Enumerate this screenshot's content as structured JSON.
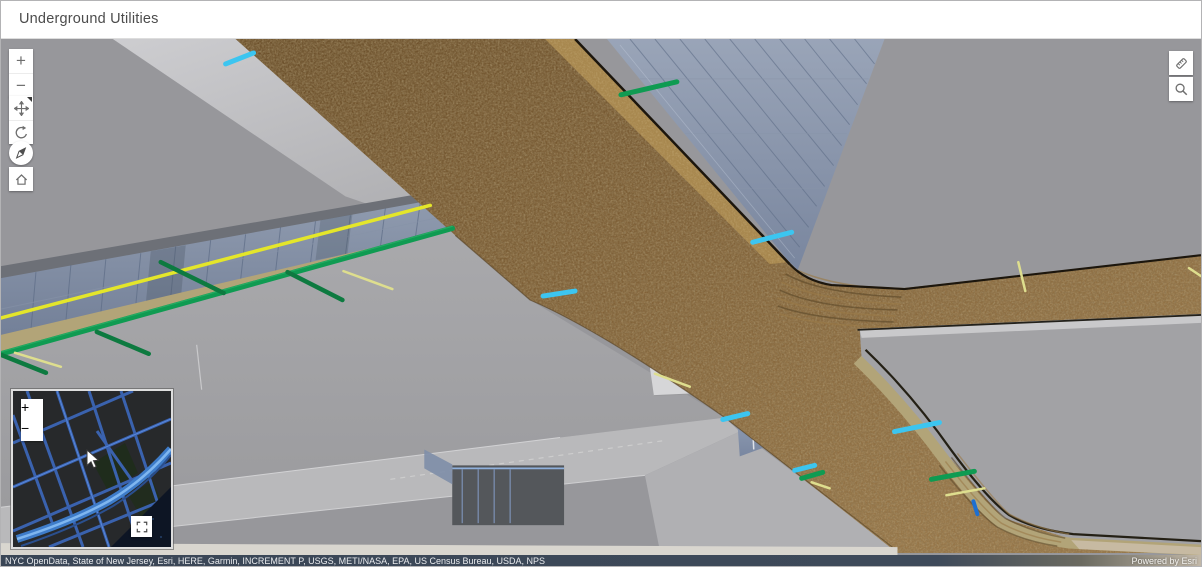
{
  "header": {
    "title": "Underground Utilities"
  },
  "navigation": {
    "zoom_in": "+",
    "zoom_out": "−",
    "left_tools": [
      "zoom-in",
      "zoom-out",
      "pan",
      "rotate",
      "compass",
      "home"
    ],
    "right_tools": [
      "measure",
      "search"
    ]
  },
  "minimap": {
    "zoom_in": "+",
    "zoom_out": "−",
    "colors": {
      "bg": "#27292b",
      "road": "#3a62ae",
      "road_bright": "#5d8de0",
      "highway": "#3e7cc9",
      "highway_core": "#7fb6ef",
      "water": "#0d1524",
      "park": "#1f2d1a"
    }
  },
  "attribution": {
    "sources": "NYC OpenData, State of New Jersey, Esri, HERE, Garmin, INCREMENT P, USGS, METI/NASA, EPA, US Census Bureau, USDA, NPS",
    "powered_by": "Powered by Esri",
    "bar_color": "#3a4656"
  },
  "scene": {
    "colors": {
      "sky": "#97979b",
      "soil_dark": "#6b4f2a",
      "soil": "#7d5e35",
      "soil_light": "#967547",
      "soil_lit_strip": "#a8884f",
      "soil_edge_dark": "#1c160d",
      "sidewalk_tan": "#b2a478",
      "glass_top": "#9aa7bd",
      "glass_bottom": "#74839f",
      "glass_mullion": "#5d6c86",
      "glass_backdrop": "#6d7077",
      "building_bright": "#c9c9cb",
      "building_wedge": "#c3c3c6",
      "building_light": "#b9b9bb",
      "building_mid": "#a2a2a5",
      "building_shadow": "#54575b",
      "bottom_strip": "#d9d6cf",
      "pipe_yellow": "#e4e62a",
      "pipe_yellow_pale": "#dede8e",
      "pipe_green": "#0f9b52",
      "pipe_green_dark": "#0d7a40",
      "pipe_cyan": "#3cc5f0",
      "pipe_blue": "#1e6fd0"
    }
  }
}
